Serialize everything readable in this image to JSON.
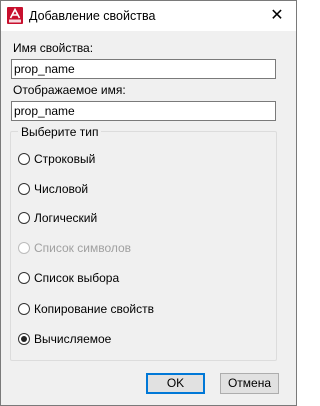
{
  "window": {
    "title": "Добавление свойства",
    "app_icon": "autocad-icon",
    "close_glyph": "✕"
  },
  "property_name": {
    "label": "Имя свойства:",
    "value": "prop_name"
  },
  "display_name": {
    "label": "Отображаемое имя:",
    "value": "prop_name"
  },
  "type_group": {
    "legend": "Выберите тип",
    "options": [
      {
        "label": "Строковый",
        "checked": false,
        "disabled": false
      },
      {
        "label": "Числовой",
        "checked": false,
        "disabled": false
      },
      {
        "label": "Логический",
        "checked": false,
        "disabled": false
      },
      {
        "label": "Список символов",
        "checked": false,
        "disabled": true
      },
      {
        "label": "Список выбора",
        "checked": false,
        "disabled": false
      },
      {
        "label": "Копирование свойств",
        "checked": false,
        "disabled": false
      },
      {
        "label": "Вычисляемое",
        "checked": true,
        "disabled": false
      }
    ]
  },
  "buttons": {
    "ok": "OK",
    "cancel": "Отмена"
  },
  "colors": {
    "accent": "#0078d7",
    "icon_red": "#c8102e",
    "dialog_bg": "#f0f0f0"
  }
}
